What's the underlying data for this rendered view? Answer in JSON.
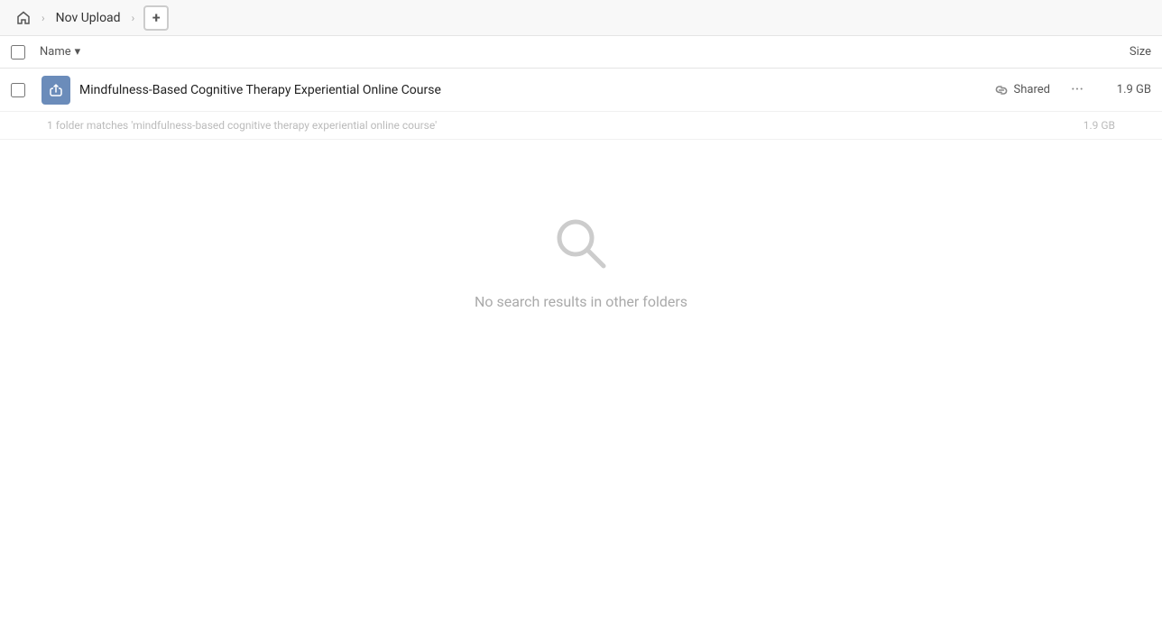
{
  "breadcrumb": {
    "home_label": "Home",
    "separator": "›",
    "nav_item": "Nov Upload",
    "add_button_label": "+"
  },
  "column_headers": {
    "name_label": "Name",
    "sort_icon": "▾",
    "size_label": "Size"
  },
  "file_row": {
    "icon_symbol": "🔗",
    "name": "Mindfulness-Based Cognitive Therapy Experiential Online Course",
    "shared_label": "Shared",
    "more_options_symbol": "···",
    "size": "1.9 GB"
  },
  "match_info": {
    "text": "1 folder matches 'mindfulness-based cognitive therapy experiential online course'",
    "size": "1.9 GB"
  },
  "empty_state": {
    "no_results_text": "No search results in other folders"
  }
}
